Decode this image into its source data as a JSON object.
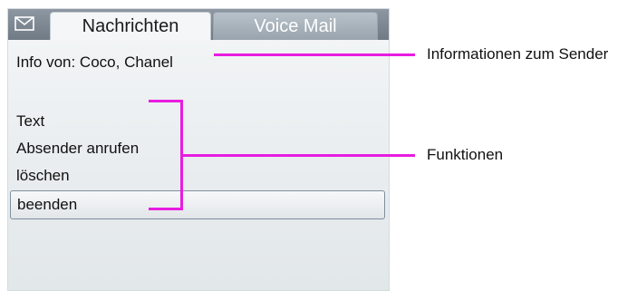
{
  "tabs": {
    "icon": "envelope-icon",
    "active_label": "Nachrichten",
    "inactive_label": "Voice Mail"
  },
  "content": {
    "info": "Info von: Coco, Chanel",
    "items": [
      "Text",
      "Absender anrufen",
      "löschen",
      "beenden"
    ]
  },
  "callouts": {
    "sender_info": "Informationen zum Sender",
    "functions": "Funktionen"
  },
  "colors": {
    "callout": "#e81ce0"
  }
}
